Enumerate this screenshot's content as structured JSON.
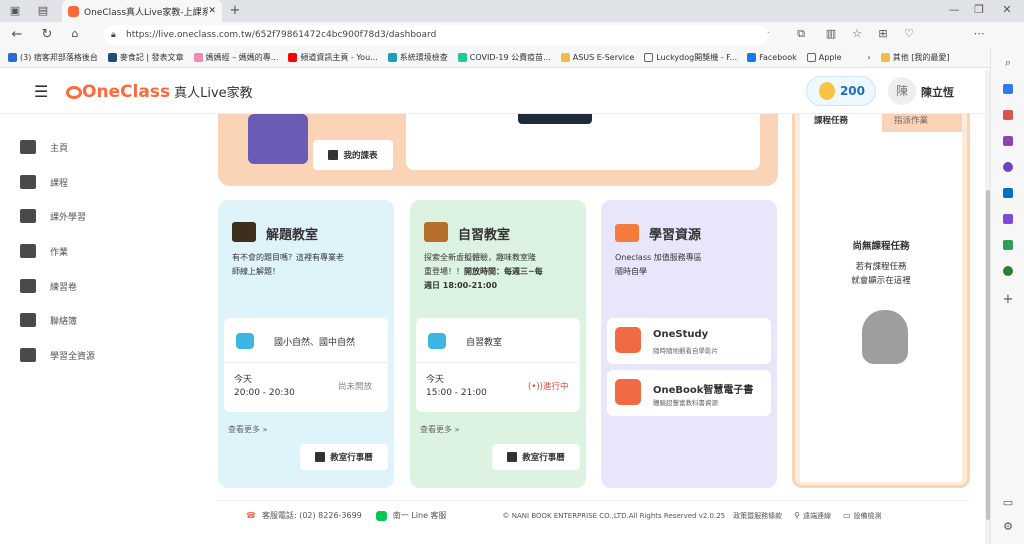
{
  "browser": {
    "tab_title": "OneClass真人Live家教-上課系統",
    "url": "https://live.oneclass.com.tw/652f79861472c4bc900f78d3/dashboard",
    "bookmarks": [
      "(3) 痞客邦部落格後台",
      "麥食記 | 發表文章",
      "媽媽經 – 媽媽的專...",
      "頻道資訊主頁 - You...",
      "系統環境檢查",
      "COVID-19 公費疫苗...",
      "ASUS E-Service",
      "Luckydog開獎機 - F...",
      "Facebook",
      "Apple"
    ],
    "other_bookmarks": "其他 [我的最愛]",
    "reader": "A"
  },
  "header": {
    "logo": "OneClass",
    "logo_sub": "真人Live家教",
    "points": "200",
    "avatar": "陳",
    "user": "陳立恆"
  },
  "nav": [
    "主頁",
    "課程",
    "課外學習",
    "作業",
    "練習卷",
    "聯絡簿",
    "學習全資源"
  ],
  "banner": {
    "schedule_btn": "我的課表"
  },
  "tasks": {
    "tab1": "課程任務",
    "tab2": "指派作業",
    "empty_title": "尚無課程任務",
    "empty_l1": "若有課程任務",
    "empty_l2": "就會顯示在這裡"
  },
  "card1": {
    "title": "解題教室",
    "desc_l1": "有不會的題目嗎？這裡有專業老",
    "desc_l2": "師線上解題！",
    "subject": "國小自然、國中自然",
    "day": "今天",
    "time": "20:00 - 20:30",
    "status": "尚未開放",
    "more": "查看更多 »",
    "btn": "教室行事曆"
  },
  "card2": {
    "title": "自習教室",
    "desc_l1": "探索全新虛擬體驗，趣味教室隆",
    "desc_l2": "重登場！！",
    "desc_bold": "開放時間：每週三~每",
    "desc_l3": "週日 18:00-21:00",
    "subject": "自習教室",
    "day": "今天",
    "time": "15:00 - 21:00",
    "status": "(•))進行中",
    "more": "查看更多 »",
    "btn": "教室行事曆"
  },
  "card3": {
    "title": "學習資源",
    "desc_l1": "Oneclass 加值服務專區",
    "desc_l2": "隨時自學",
    "r1_title": "OneStudy",
    "r1_sub": "隨時隨地觀看自學影片",
    "r2_title": "OneBook智慧電子書",
    "r2_sub": "體驗超豐富教科書資源"
  },
  "footer": {
    "phone": "客服電話: (02) 8226-3699",
    "line": "南一 Line 客服",
    "copy": "© NANI BOOK ENTERPRISE CO.,LTD.All Rights Reserved v2.0.25",
    "policy": "政策暨服務條款",
    "remote": "遠端連線",
    "device": "設備檢測"
  },
  "colors": {
    "accent": "#ff6a3d",
    "card1": "#dff3fb",
    "card2": "#dcf3e1",
    "card3": "#e9e6fb",
    "banner": "#fbd4b8"
  }
}
